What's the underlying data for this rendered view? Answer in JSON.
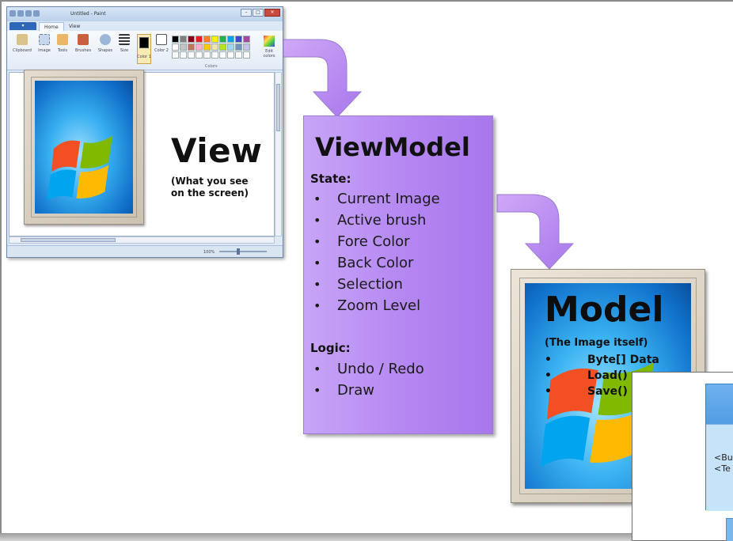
{
  "view": {
    "title": "View",
    "subtitle_line1": "(What you see",
    "subtitle_line2": "on the screen)"
  },
  "paint_window": {
    "window_title": "Untitled - Paint",
    "tabs": [
      "Home",
      "View"
    ],
    "file_tab": "",
    "ribbon_groups": [
      "Clipboard",
      "Image",
      "Tools",
      "Brushes",
      "Shapes",
      "Size",
      "Color 1",
      "Color 2",
      "Edit colors"
    ],
    "group_caption": "Colors",
    "zoom_level": "100%",
    "palette": [
      "#000000",
      "#7f7f7f",
      "#880015",
      "#ed1c24",
      "#ff7f27",
      "#fff200",
      "#22b14c",
      "#00a2e8",
      "#3f48cc",
      "#a349a4",
      "#ffffff",
      "#c3c3c3",
      "#b97a57",
      "#ffaec9",
      "#ffc90e",
      "#efe4b0",
      "#b5e61d",
      "#99d9ea",
      "#7092be",
      "#c8bfe7",
      "#ffffff",
      "#ffffff",
      "#ffffff",
      "#ffffff",
      "#ffffff",
      "#ffffff",
      "#ffffff",
      "#ffffff",
      "#ffffff",
      "#ffffff"
    ]
  },
  "viewmodel": {
    "title": "ViewModel",
    "state_heading": "State:",
    "state_items": [
      "Current Image",
      "Active brush",
      "Fore Color",
      "Back Color",
      "Selection",
      "Zoom Level"
    ],
    "logic_heading": "Logic:",
    "logic_items": [
      "Undo / Redo",
      "Draw"
    ]
  },
  "model": {
    "title": "Model",
    "subtitle": "(The Image itself)",
    "items": [
      "Byte[] Data",
      "Load()",
      "Save()"
    ]
  },
  "xaml_window": {
    "code_line1": "<Bu",
    "code_line2": "<Te"
  },
  "colors": {
    "viewmodel_fill": "#b486f2",
    "arrow_fill": "#b88af0",
    "windows_blue": "#36aef0"
  }
}
